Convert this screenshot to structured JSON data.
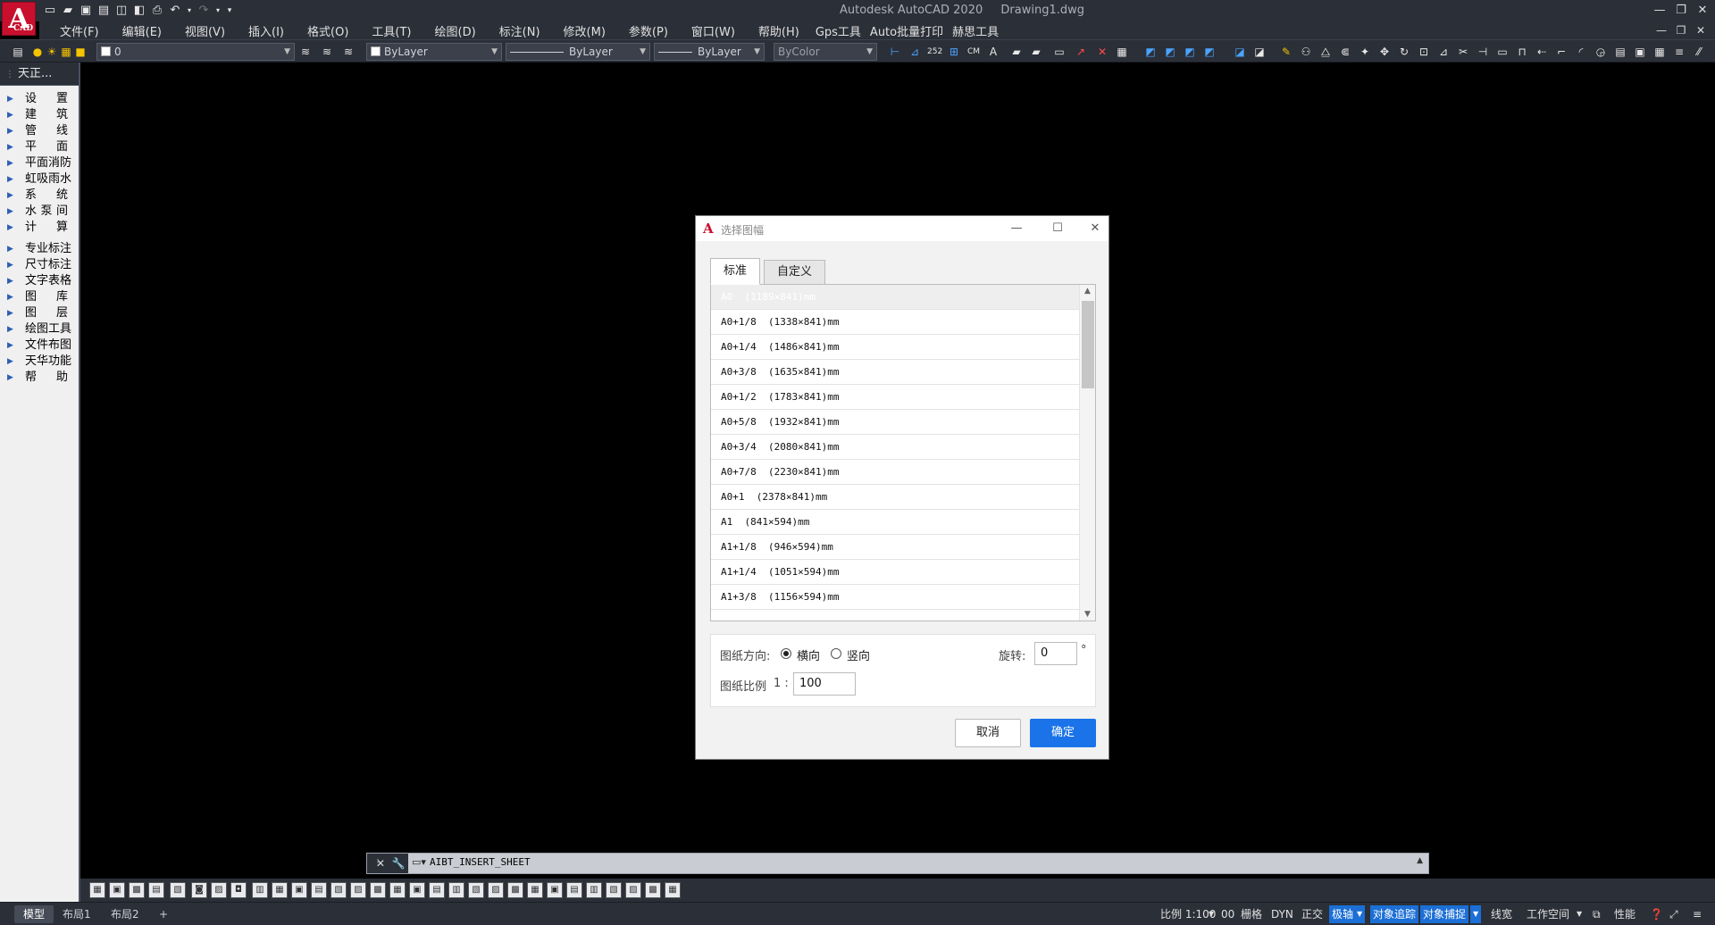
{
  "title_bar": {
    "app_name": "Autodesk AutoCAD 2020",
    "document": "Drawing1.dwg",
    "logo_letter": "A",
    "logo_sub": "CAD"
  },
  "menu": {
    "items": [
      "文件(F)",
      "编辑(E)",
      "视图(V)",
      "插入(I)",
      "格式(O)",
      "工具(T)",
      "绘图(D)",
      "标注(N)",
      "修改(M)",
      "参数(P)",
      "窗口(W)",
      "帮助(H)",
      "Gps工具",
      "Auto批量打印",
      "赫思工具"
    ]
  },
  "toolbar": {
    "layer_value": "0",
    "color_value": "ByLayer",
    "linetype_value": "ByLayer",
    "lineweight_value": "ByLayer",
    "plotstyle_value": "ByColor"
  },
  "left_panel": {
    "title": "天正...",
    "group1": [
      "设　置",
      "建　筑",
      "管　线",
      "平　面",
      "平面消防",
      "虹吸雨水",
      "系　统",
      "水 泵 间",
      "计　算"
    ],
    "group2": [
      "专业标注",
      "尺寸标注",
      "文字表格",
      "图　库",
      "图　层",
      "绘图工具",
      "文件布图",
      "天华功能",
      "帮　助"
    ]
  },
  "command_line": {
    "text": "AIBT_INSERT_SHEET"
  },
  "status_bar": {
    "tabs": [
      "模型",
      "布局1",
      "布局2"
    ],
    "add_tab": "+",
    "scale": "比例 1:100",
    "scale_num": "00",
    "grid": "栅格",
    "dyn": "DYN",
    "ortho": "正交",
    "polar": "极轴",
    "otrack": "对象追踪",
    "osnap": "对象捕捉",
    "lineweight": "线宽",
    "workspace": "工作空间",
    "performance": "性能"
  },
  "dialog": {
    "title": "选择图幅",
    "tabs": [
      "标准",
      "自定义"
    ],
    "sheets": [
      "A0  (1189×841)mm",
      "A0+1/8  (1338×841)mm",
      "A0+1/4  (1486×841)mm",
      "A0+3/8  (1635×841)mm",
      "A0+1/2  (1783×841)mm",
      "A0+5/8  (1932×841)mm",
      "A0+3/4  (2080×841)mm",
      "A0+7/8  (2230×841)mm",
      "A0+1  (2378×841)mm",
      "A1  (841×594)mm",
      "A1+1/8  (946×594)mm",
      "A1+1/4  (1051×594)mm",
      "A1+3/8  (1156×594)mm"
    ],
    "orientation_label": "图纸方向:",
    "landscape": "横向",
    "portrait": "竖向",
    "orientation_selected": "横向",
    "rotation_label": "旋转:",
    "rotation_value": "0",
    "rotation_unit": "°",
    "scale_label": "图纸比例",
    "scale_prefix": "1 :",
    "scale_value": "100",
    "cancel": "取消",
    "ok": "确定"
  },
  "colors": {
    "chrome": "#2b2f38",
    "accent": "#1a73e8",
    "logo_red": "#c8102e"
  }
}
